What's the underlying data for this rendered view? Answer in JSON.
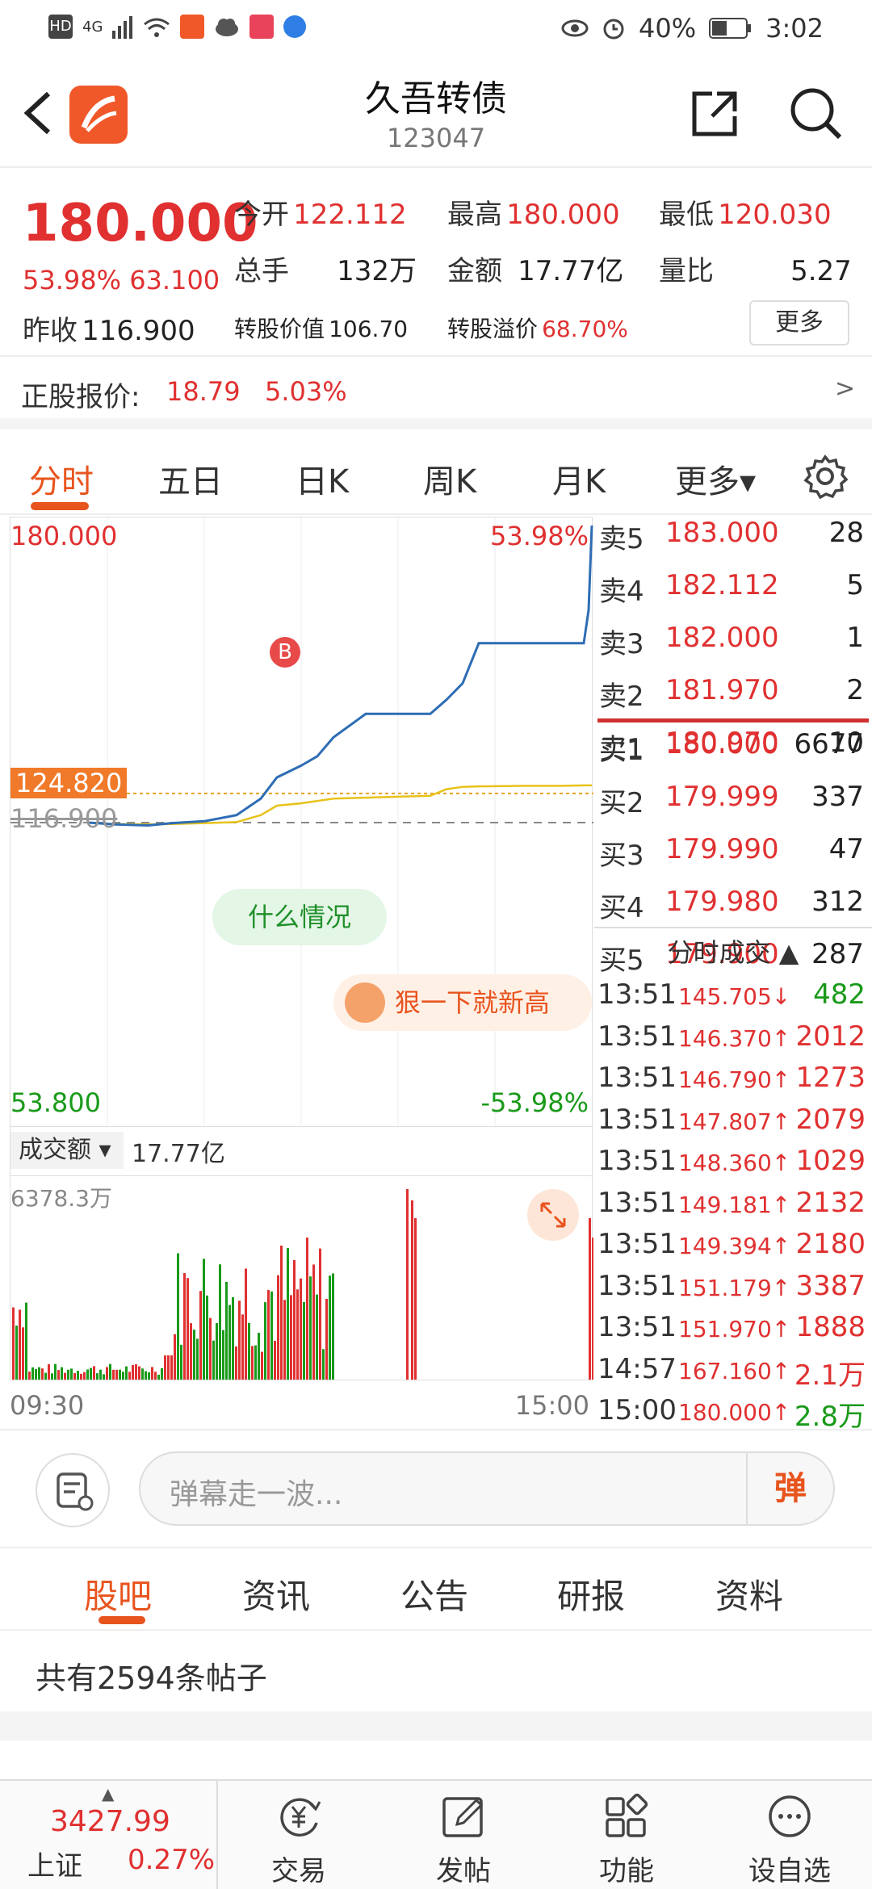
{
  "status_bar": {
    "hd": "HD",
    "net": "4G",
    "battery": "40%",
    "time": "3:02"
  },
  "header": {
    "title": "久吾转债",
    "code": "123047"
  },
  "quote": {
    "price": "180.000",
    "change_pct": "53.98%",
    "change_abs": "63.100",
    "prev_close_label": "昨收",
    "prev_close": "116.900",
    "open_label": "今开",
    "open": "122.112",
    "high_label": "最高",
    "high": "180.000",
    "low_label": "最低",
    "low": "120.030",
    "volume_label": "总手",
    "volume": "132万",
    "amount_label": "金额",
    "amount": "17.77亿",
    "ratio_label": "量比",
    "ratio": "5.27",
    "conv_value_label": "转股价值",
    "conv_value": "106.70",
    "conv_premium_label": "转股溢价",
    "conv_premium": "68.70%",
    "more_label": "更多"
  },
  "stock": {
    "label": "正股报价:",
    "price": "18.79",
    "change": "5.03%",
    "arrow": ">"
  },
  "chart_tabs": [
    "分时",
    "五日",
    "日K",
    "周K",
    "月K",
    "更多▾"
  ],
  "chart": {
    "top_price": "180.000",
    "top_pct": "53.98%",
    "bottom_price": "53.800",
    "bottom_pct": "-53.98%",
    "current_tag": "124.820",
    "prev_close": "116.900",
    "marker": "B",
    "pill_1": "什么情况",
    "pill_2": "狠一下就新高",
    "volume_selector": "成交额 ▾",
    "volume_total": "17.77亿",
    "volume_max": "6378.3万",
    "time_start": "09:30",
    "time_end": "15:00"
  },
  "chart_data": {
    "type": "line",
    "title": "",
    "xlabel": "",
    "ylabel": "",
    "ylim": [
      53.8,
      180.0
    ],
    "x_range": [
      "09:30",
      "15:00"
    ],
    "reference_line": 116.9,
    "series": [
      {
        "values": [
          116.9,
          116.5,
          116.3,
          116.8,
          117.2,
          118.5,
          122.0,
          126.5,
          129.0,
          131.0,
          135.0,
          140.0,
          140.0,
          140.0,
          143.0,
          146.5,
          155.0,
          155.0,
          155.0,
          155.0,
          162.0,
          180.0
        ]
      },
      {
        "values": [
          116.9,
          116.6,
          116.5,
          116.6,
          116.8,
          117.0,
          118.5,
          120.5,
          121.0,
          121.5,
          122.0,
          122.2,
          122.4,
          122.6,
          124.0,
          124.5,
          124.6,
          124.7,
          124.7,
          124.8,
          124.8,
          124.8
        ]
      }
    ]
  },
  "order_book": {
    "asks": [
      {
        "label": "卖5",
        "price": "183.000",
        "vol": "28"
      },
      {
        "label": "卖4",
        "price": "182.112",
        "vol": "5"
      },
      {
        "label": "卖3",
        "price": "182.000",
        "vol": "1"
      },
      {
        "label": "卖2",
        "price": "181.970",
        "vol": "2"
      },
      {
        "label": "卖1",
        "price": "180.970",
        "vol": "10"
      }
    ],
    "bids": [
      {
        "label": "买1",
        "price": "180.000",
        "vol": "6677"
      },
      {
        "label": "买2",
        "price": "179.999",
        "vol": "337"
      },
      {
        "label": "买3",
        "price": "179.990",
        "vol": "47"
      },
      {
        "label": "买4",
        "price": "179.980",
        "vol": "312"
      },
      {
        "label": "买5",
        "price": "179.900",
        "vol": "287"
      }
    ],
    "trades_header": "分时成交 ▲",
    "trades": [
      {
        "time": "13:51",
        "price": "145.705↓",
        "vol": "482",
        "dir": "down"
      },
      {
        "time": "13:51",
        "price": "146.370↑",
        "vol": "2012",
        "dir": "up"
      },
      {
        "time": "13:51",
        "price": "146.790↑",
        "vol": "1273",
        "dir": "up"
      },
      {
        "time": "13:51",
        "price": "147.807↑",
        "vol": "2079",
        "dir": "up"
      },
      {
        "time": "13:51",
        "price": "148.360↑",
        "vol": "1029",
        "dir": "up"
      },
      {
        "time": "13:51",
        "price": "149.181↑",
        "vol": "2132",
        "dir": "up"
      },
      {
        "time": "13:51",
        "price": "149.394↑",
        "vol": "2180",
        "dir": "up"
      },
      {
        "time": "13:51",
        "price": "151.179↑",
        "vol": "3387",
        "dir": "up"
      },
      {
        "time": "13:51",
        "price": "151.970↑",
        "vol": "1888",
        "dir": "up"
      },
      {
        "time": "14:57",
        "price": "167.160↑",
        "vol": "2.1万",
        "dir": "up"
      },
      {
        "time": "15:00",
        "price": "180.000↑",
        "vol": "2.8万",
        "dir": "down"
      }
    ]
  },
  "danmu": {
    "placeholder": "弹幕走一波...",
    "send": "弹"
  },
  "bottom_tabs": [
    "股吧",
    "资讯",
    "公告",
    "研报",
    "资料"
  ],
  "post_count": "共有2594条帖子",
  "bottom_nav": {
    "index_value": "3427.99",
    "index_name": "上证",
    "index_change": "0.27%",
    "items": [
      "交易",
      "发帖",
      "功能",
      "设自选"
    ]
  },
  "colors": {
    "up": "#e03030",
    "down": "#1a9a1a",
    "accent": "#e8541e",
    "price_line": "#2e6db4",
    "avg_line": "#e8c21a"
  }
}
